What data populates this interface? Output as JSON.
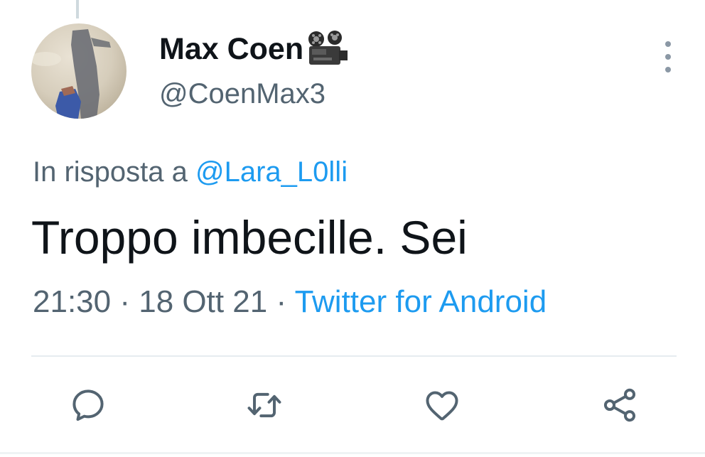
{
  "tweet": {
    "author": {
      "display_name": "Max Coen",
      "display_name_emoji": "movie-camera-emoji",
      "handle": "@CoenMax3"
    },
    "reply_prefix": "In risposta a",
    "reply_to": "@Lara_L0lli",
    "text": "Troppo imbecille. Sei",
    "time": "21:30",
    "separator": "·",
    "date": "18 Ott 21",
    "source": "Twitter for Android"
  },
  "actions": {
    "reply_icon": "reply-icon",
    "retweet_icon": "retweet-icon",
    "like_icon": "heart-icon",
    "share_icon": "share-icon"
  },
  "colors": {
    "link": "#1d9bf0",
    "secondary_text": "#536471",
    "primary_text": "#0f1419",
    "icon": "#536471"
  }
}
